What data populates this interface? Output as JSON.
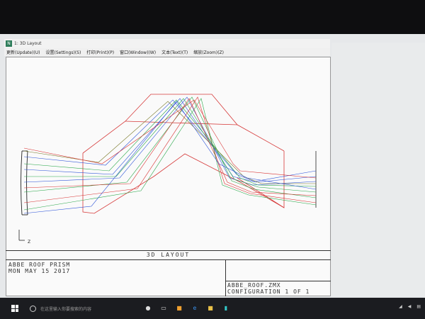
{
  "window": {
    "title": "1: 3D Layout"
  },
  "menu": [
    {
      "label": "更新(Update)(U)"
    },
    {
      "label": "设置(Settings)(S)"
    },
    {
      "label": "打印(Print)(P)"
    },
    {
      "label": "窗口(Window)(W)"
    },
    {
      "label": "文本(Text)(T)"
    },
    {
      "label": "缩放(Zoom)(Z)"
    }
  ],
  "plot": {
    "axis_label": "Z"
  },
  "stamp": {
    "title": "3D LAYOUT",
    "line1": "ABBE ROOF PRISM",
    "line2": "MON MAY 15 2017",
    "file": "ABBE_ROOF.ZMX",
    "config": "CONFIGURATION 1 OF 1"
  },
  "taskbar": {
    "search_placeholder": "在这里输入你要搜索的内容"
  },
  "colors": {
    "prism": "#d63a3a",
    "ray_blue": "#2f55d8",
    "ray_green": "#2aa84a",
    "ray_red": "#d83030"
  }
}
